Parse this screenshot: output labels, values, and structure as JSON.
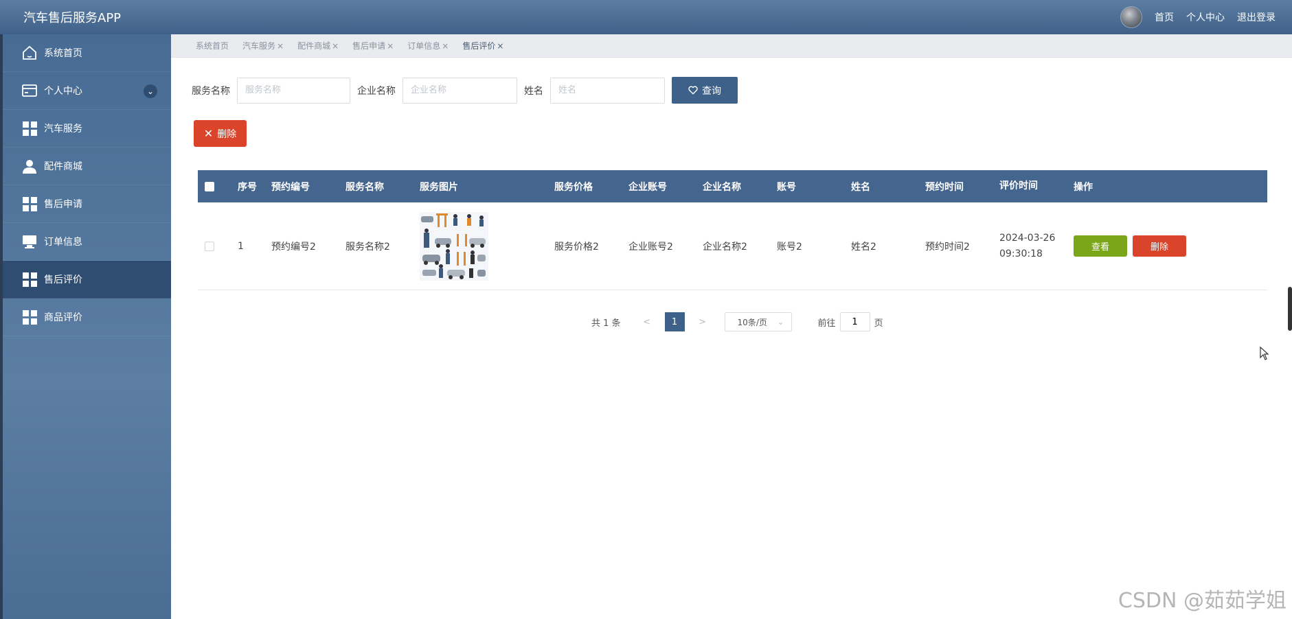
{
  "header": {
    "app_title": "汽车售后服务APP",
    "links": [
      "首页",
      "个人中心",
      "退出登录"
    ]
  },
  "sidebar": {
    "items": [
      {
        "label": "系统首页",
        "icon": "home-icon"
      },
      {
        "label": "个人中心",
        "icon": "card-icon"
      },
      {
        "label": "汽车服务",
        "icon": "grid-icon"
      },
      {
        "label": "配件商城",
        "icon": "user-icon"
      },
      {
        "label": "售后申请",
        "icon": "grid-icon"
      },
      {
        "label": "订单信息",
        "icon": "monitor-icon"
      },
      {
        "label": "售后评价",
        "icon": "grid-icon"
      },
      {
        "label": "商品评价",
        "icon": "grid-icon"
      }
    ],
    "active": "售后评价"
  },
  "tabs": [
    {
      "label": "系统首页",
      "closable": false
    },
    {
      "label": "汽车服务",
      "closable": true
    },
    {
      "label": "配件商城",
      "closable": true
    },
    {
      "label": "售后申请",
      "closable": true
    },
    {
      "label": "订单信息",
      "closable": true
    },
    {
      "label": "售后评价",
      "closable": true,
      "active": true
    }
  ],
  "search": {
    "service_name_label": "服务名称",
    "service_name_placeholder": "服务名称",
    "company_name_label": "企业名称",
    "company_name_placeholder": "企业名称",
    "name_label": "姓名",
    "name_placeholder": "姓名",
    "query_label": "查询"
  },
  "toolbar": {
    "delete_label": "删除"
  },
  "table": {
    "headers": [
      "序号",
      "预约编号",
      "服务名称",
      "服务图片",
      "服务价格",
      "企业账号",
      "企业名称",
      "账号",
      "姓名",
      "预约时间",
      "评价时间",
      "操作"
    ],
    "rows": [
      {
        "index": "1",
        "code": "预约编号2",
        "service_name": "服务名称2",
        "price": "服务价格2",
        "company_account": "企业账号2",
        "company_name": "企业名称2",
        "account": "账号2",
        "name": "姓名2",
        "booking_time": "预约时间2",
        "eval_date": "2024-03-26",
        "eval_time": "09:30:18",
        "view_label": "查看",
        "delete_label": "删除"
      }
    ]
  },
  "pagination": {
    "total_text": "共 1 条",
    "current_page": "1",
    "page_size": "10条/页",
    "goto_prefix": "前往",
    "goto_value": "1",
    "goto_suffix": "页"
  },
  "watermark": "CSDN @茹茹学姐",
  "colors": {
    "primary": "#3e6189",
    "danger": "#d9442b",
    "success": "#7ca61a"
  }
}
